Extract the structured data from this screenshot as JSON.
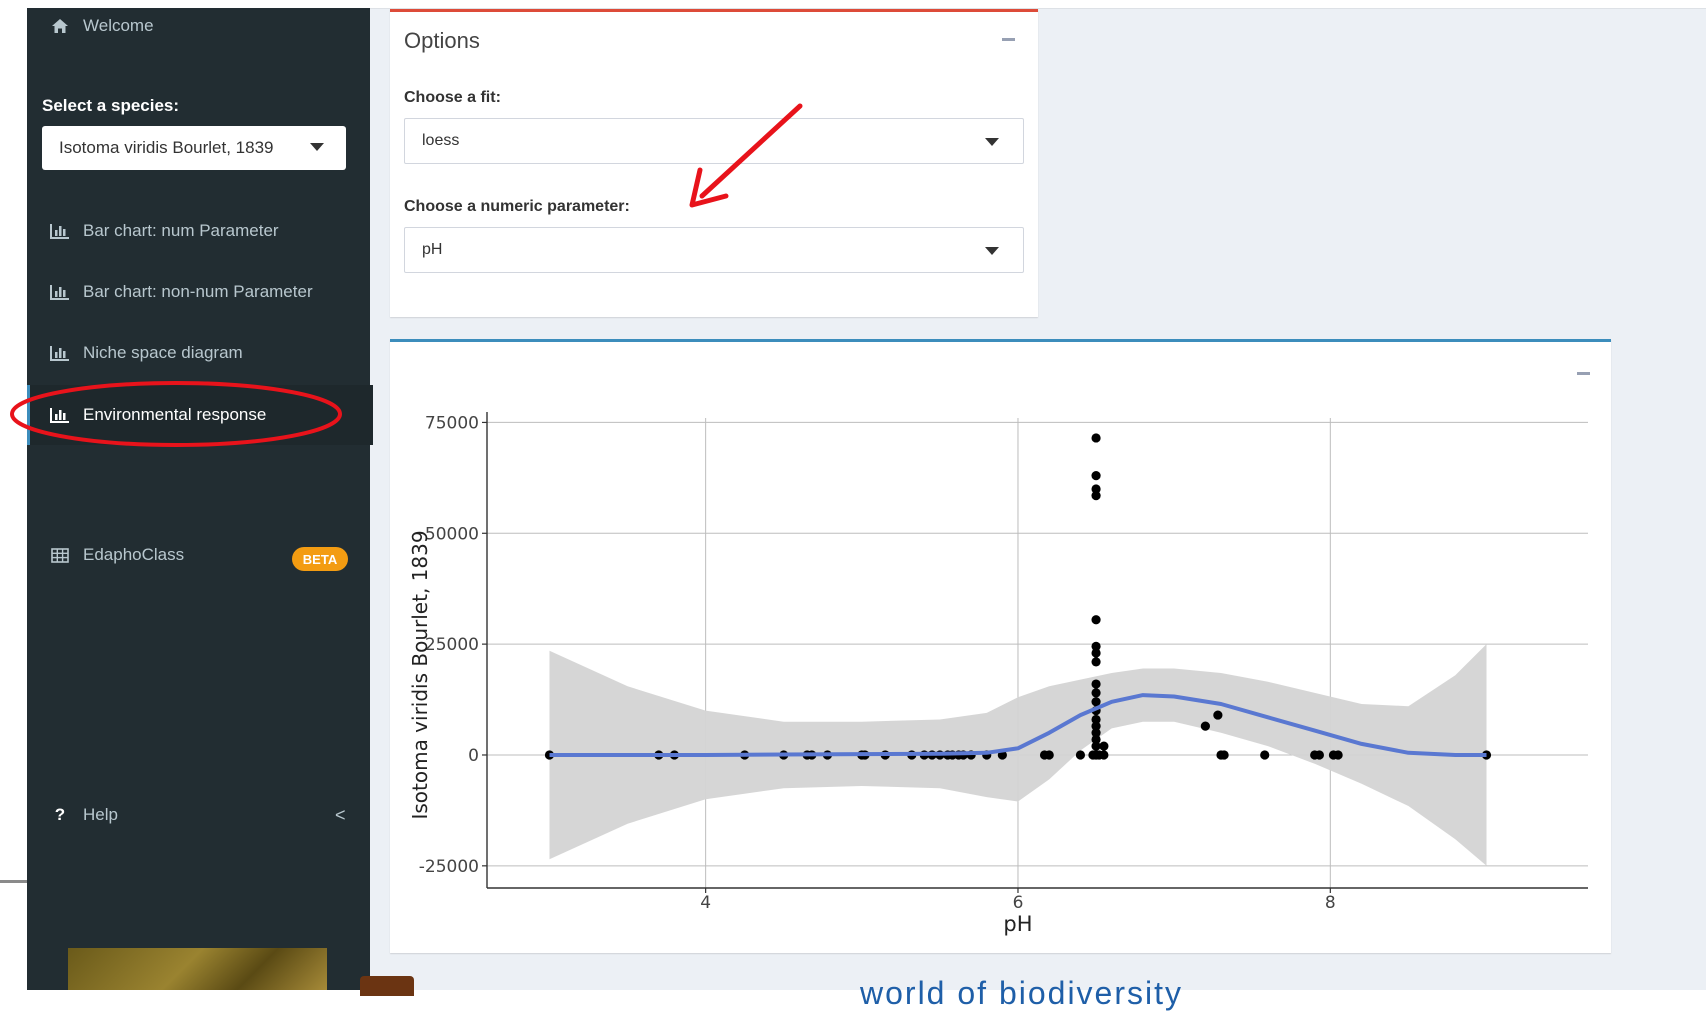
{
  "sidebar": {
    "welcome": "Welcome",
    "species_label": "Select a species:",
    "species_value": "Isotoma viridis Bourlet, 1839",
    "items": [
      {
        "label": "Bar chart: num Parameter",
        "icon": "bar-chart-icon"
      },
      {
        "label": "Bar chart: non-num Parameter",
        "icon": "bar-chart-icon"
      },
      {
        "label": "Niche space diagram",
        "icon": "bar-chart-icon"
      },
      {
        "label": "Environmental response",
        "icon": "bar-chart-icon",
        "active": true
      }
    ],
    "edapho": {
      "label": "EdaphoClass",
      "badge": "BETA",
      "icon": "table-icon"
    },
    "help": {
      "label": "Help",
      "icon_text": "?",
      "chevron": "<"
    }
  },
  "options": {
    "title": "Options",
    "fit_label": "Choose a fit:",
    "fit_value": "loess",
    "param_label": "Choose a numeric parameter:",
    "param_value": "pH"
  },
  "bottom": {
    "partial_text": "world of biodiversity"
  },
  "annotations": {
    "color": "#e8131b"
  },
  "chart_data": {
    "type": "scatter",
    "xlabel": "pH",
    "ylabel": "Isotoma viridis Bourlet, 1839",
    "xlim": [
      2.6,
      9.65
    ],
    "ylim": [
      -30000,
      76000
    ],
    "x_ticks": [
      4,
      6,
      8
    ],
    "y_ticks": [
      -25000,
      0,
      25000,
      50000,
      75000
    ],
    "y_tick_labels": [
      "-25000",
      "0",
      "25000",
      "50000",
      "75000"
    ],
    "grid": true,
    "points": [
      [
        3.0,
        0
      ],
      [
        3.7,
        0
      ],
      [
        3.8,
        0
      ],
      [
        4.25,
        0
      ],
      [
        4.5,
        0
      ],
      [
        4.65,
        0
      ],
      [
        4.68,
        0
      ],
      [
        4.78,
        0
      ],
      [
        5.0,
        0
      ],
      [
        5.02,
        0
      ],
      [
        5.15,
        0
      ],
      [
        5.32,
        0
      ],
      [
        5.4,
        0
      ],
      [
        5.45,
        0
      ],
      [
        5.5,
        0
      ],
      [
        5.55,
        0
      ],
      [
        5.58,
        0
      ],
      [
        5.62,
        0
      ],
      [
        5.65,
        0
      ],
      [
        5.7,
        0
      ],
      [
        5.8,
        0
      ],
      [
        5.9,
        0
      ],
      [
        6.17,
        0
      ],
      [
        6.2,
        0
      ],
      [
        6.4,
        0
      ],
      [
        6.48,
        0
      ],
      [
        6.5,
        0
      ],
      [
        6.52,
        0
      ],
      [
        6.55,
        0
      ],
      [
        6.5,
        71500
      ],
      [
        6.5,
        63000
      ],
      [
        6.5,
        60000
      ],
      [
        6.5,
        58500
      ],
      [
        6.5,
        30500
      ],
      [
        6.5,
        24500
      ],
      [
        6.5,
        23000
      ],
      [
        6.5,
        21000
      ],
      [
        6.5,
        16000
      ],
      [
        6.5,
        14000
      ],
      [
        6.5,
        12000
      ],
      [
        6.5,
        10000
      ],
      [
        6.5,
        8000
      ],
      [
        6.5,
        6500
      ],
      [
        6.5,
        5000
      ],
      [
        6.5,
        3500
      ],
      [
        6.5,
        2000
      ],
      [
        6.55,
        2000
      ],
      [
        7.2,
        6500
      ],
      [
        7.28,
        9000
      ],
      [
        7.3,
        0
      ],
      [
        7.32,
        0
      ],
      [
        7.58,
        0
      ],
      [
        7.9,
        0
      ],
      [
        7.93,
        0
      ],
      [
        8.02,
        0
      ],
      [
        8.05,
        0
      ],
      [
        9.0,
        0
      ]
    ],
    "fit": {
      "method": "loess",
      "x": [
        3.0,
        3.5,
        4.0,
        4.5,
        5.0,
        5.5,
        5.8,
        6.0,
        6.2,
        6.4,
        6.6,
        6.8,
        7.0,
        7.3,
        7.6,
        7.9,
        8.2,
        8.5,
        8.8,
        9.0
      ],
      "y": [
        0,
        0,
        0,
        100,
        200,
        300,
        500,
        1500,
        5000,
        9000,
        12000,
        13500,
        13200,
        11500,
        8500,
        5500,
        2500,
        500,
        0,
        0
      ],
      "ci_upper": [
        23500,
        15500,
        10000,
        7500,
        7500,
        8000,
        9500,
        13000,
        15500,
        17000,
        18500,
        19500,
        19500,
        18500,
        16500,
        14000,
        11500,
        11000,
        18000,
        25000
      ],
      "ci_lower": [
        -23500,
        -15500,
        -10000,
        -7500,
        -7000,
        -7500,
        -9500,
        -10500,
        -5500,
        1000,
        6000,
        7500,
        7500,
        5000,
        2000,
        -2000,
        -6500,
        -11500,
        -19000,
        -25000
      ]
    },
    "colors": {
      "points": "#000000",
      "line": "#5a78d1",
      "ribbon": "#d4d4d4"
    }
  }
}
